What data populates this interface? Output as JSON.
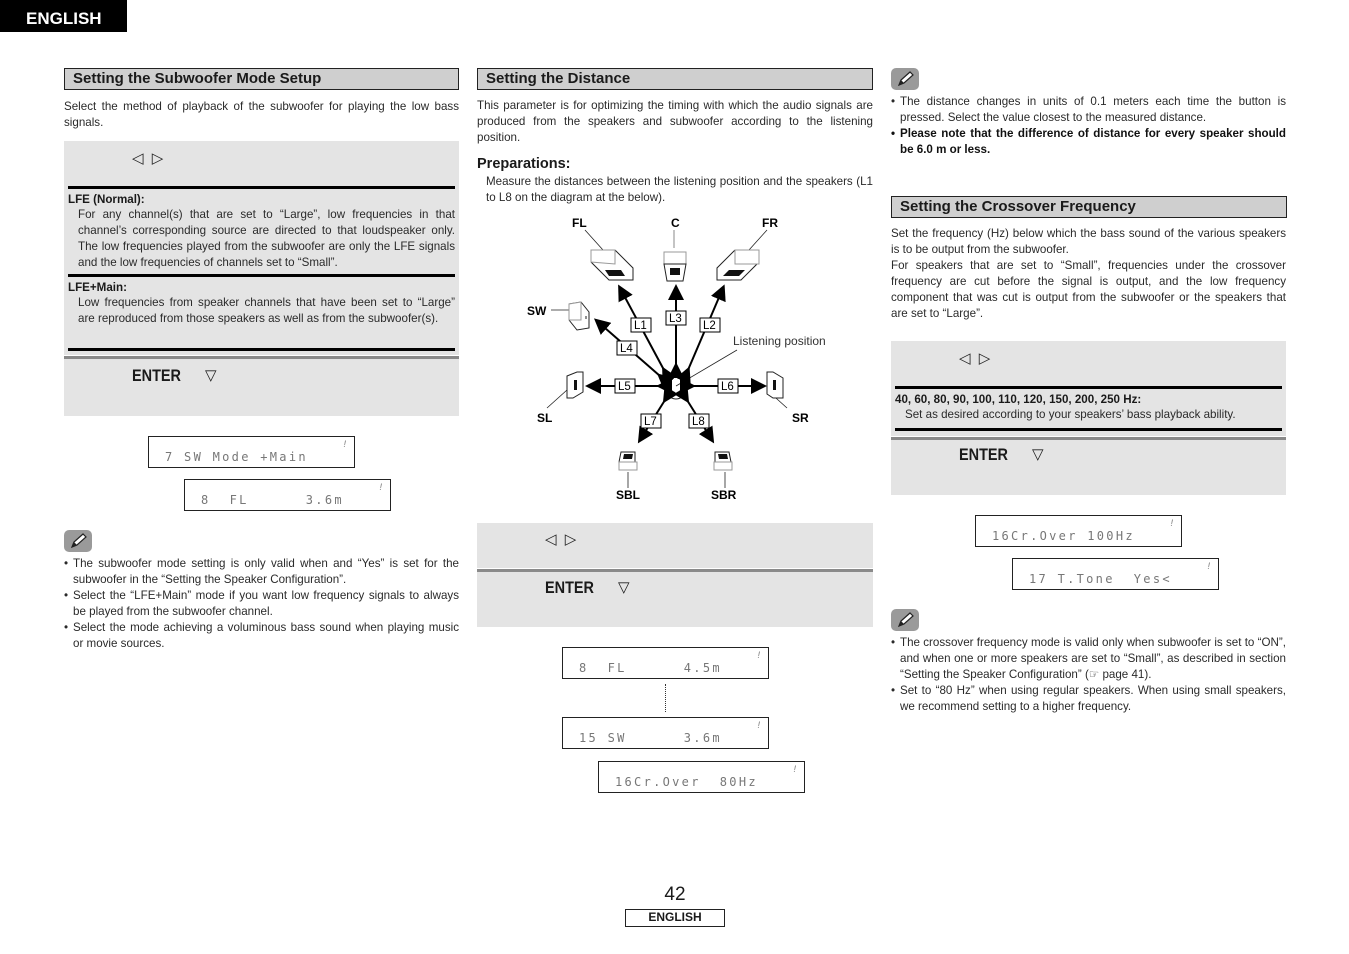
{
  "header": {
    "language_tab": "ENGLISH"
  },
  "col1": {
    "title": "Setting the Subwoofer Mode Setup",
    "intro": "Select the method of playback of the subwoofer for playing the low bass signals.",
    "step1_arrows": "◁ ▷",
    "options": [
      {
        "name": "LFE (Normal):",
        "desc": "For any channel(s) that are set to “Large”, low frequencies in that channel’s corresponding source are directed to that loudspeaker only. The low frequencies played from the subwoofer are only the LFE signals and the low frequencies of channels set to “Small”."
      },
      {
        "name": "LFE+Main:",
        "desc": "Low frequencies from speaker channels that have been set to “Large” are reproduced from those speakers as well as from the subwoofer(s)."
      }
    ],
    "step2_label": "ENTER",
    "step2_arrow": "▽",
    "lcd": [
      {
        "text": "7 SW Mode +Main"
      },
      {
        "text": "8  FL      3.6m"
      }
    ],
    "notes": [
      "The subwoofer mode setting is only valid when and “Yes” is set for the subwoofer in the “Setting the Speaker Configuration”.",
      "Select the “LFE+Main” mode if you want low frequency signals to always be played from the subwoofer channel.",
      "Select the mode achieving a voluminous bass sound when playing music or movie sources."
    ]
  },
  "col2": {
    "title": "Setting the Distance",
    "intro": "This parameter is for optimizing the timing with which the audio signals are produced from the speakers and subwoofer according to the listening position.",
    "prep_heading": "Preparations:",
    "prep_text": "Measure the distances between the listening position and the speakers (L1 to L8 on the diagram at the below).",
    "diagram": {
      "speakers": [
        "FL",
        "C",
        "FR",
        "SW",
        "SL",
        "SR",
        "SBL",
        "SBR"
      ],
      "distances": [
        "L1",
        "L2",
        "L3",
        "L4",
        "L5",
        "L6",
        "L7",
        "L8"
      ],
      "listening_label": "Listening position"
    },
    "step1_arrows": "◁ ▷",
    "step2_label": "ENTER",
    "step2_arrow": "▽",
    "lcd": [
      {
        "text": "8  FL      4.5m"
      },
      {
        "text": "15 SW      3.6m"
      },
      {
        "text": "16Cr.Over  80Hz"
      }
    ]
  },
  "col3": {
    "notes": [
      {
        "text": "The distance changes in units of 0.1 meters each time the button is pressed. Select the value closest to the measured distance.",
        "bold": false
      },
      {
        "text": "Please note that the difference of distance for every speaker should be 6.0 m or less.",
        "bold": true
      }
    ],
    "title": "Setting the Crossover Frequency",
    "intro1": "Set the frequency (Hz) below which the bass sound of the various speakers is to be output from the subwoofer.",
    "intro2": "For speakers that are set to “Small”, frequencies under the crossover frequency are cut before the signal is output, and the low frequency component that was cut is output from the subwoofer or the speakers that are set to “Large”.",
    "step1_arrows": "◁ ▷",
    "option_name": "40, 60, 80, 90, 100, 110, 120, 150, 200, 250 Hz:",
    "option_desc": "Set as desired according to your speakers’ bass playback ability.",
    "step2_label": "ENTER",
    "step2_arrow": "▽",
    "lcd": [
      {
        "text": "16Cr.Over 100Hz"
      },
      {
        "text": "17 T.Tone  Yes<"
      }
    ],
    "notes2": [
      "The crossover frequency mode is valid only when subwoofer is set to “ON”, and when one or more speakers are set to “Small”, as described in section “Setting the Speaker Configuration” (☞ page 41).",
      "Set to “80 Hz” when using regular speakers. When using small speakers, we recommend setting to a higher frequency."
    ]
  },
  "footer": {
    "page_number": "42",
    "language": "ENGLISH"
  }
}
